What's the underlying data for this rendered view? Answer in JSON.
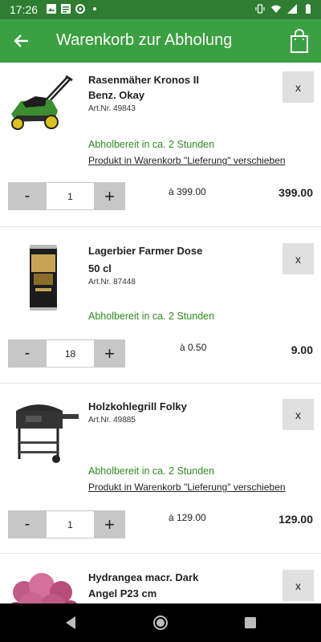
{
  "status_bar": {
    "time": "17:26",
    "left_icons": [
      "image-icon",
      "news-icon",
      "sync-icon",
      "dot-icon"
    ],
    "right_icons": [
      "vibrate-icon",
      "wifi-icon",
      "signal-icon",
      "battery-icon"
    ]
  },
  "app_bar": {
    "title": "Warenkorb zur Abholung",
    "back_icon": "arrow-back-icon",
    "cart_icon": "shopping-bag-icon",
    "color": "#3aa041"
  },
  "items": [
    {
      "name_line1": "Rasenmäher Kronos II",
      "name_line2": "Benz. Okay",
      "art_nr": "Art.Nr. 49843",
      "availability": "Abholbereit in ca. 2 Stunden",
      "move_link": "Produkt in Warenkorb \"Lieferung\" verschieben",
      "quantity": "1",
      "unit_price": "à 399.00",
      "total": "399.00",
      "remove_label": "x",
      "minus_label": "-",
      "plus_label": "+"
    },
    {
      "name_line1": "Lagerbier Farmer Dose",
      "name_line2": "50 cl",
      "art_nr": "Art.Nr. 87448",
      "availability": "Abholbereit in ca. 2 Stunden",
      "quantity": "18",
      "unit_price": "à 0.50",
      "total": "9.00",
      "remove_label": "x",
      "minus_label": "-",
      "plus_label": "+"
    },
    {
      "name_line1": "Holzkohlegrill Folky",
      "art_nr": "Art.Nr. 49885",
      "availability": "Abholbereit in ca. 2 Stunden",
      "move_link": "Produkt in Warenkorb \"Lieferung\" verschieben",
      "quantity": "1",
      "unit_price": "à 129.00",
      "total": "129.00",
      "remove_label": "x",
      "minus_label": "-",
      "plus_label": "+"
    },
    {
      "name_line1": "Hydrangea macr. Dark",
      "name_line2": "Angel P23 cm",
      "remove_label": "x"
    }
  ],
  "nav_bar": {
    "icons": [
      "back-triangle-icon",
      "home-circle-icon",
      "recents-square-icon"
    ]
  }
}
